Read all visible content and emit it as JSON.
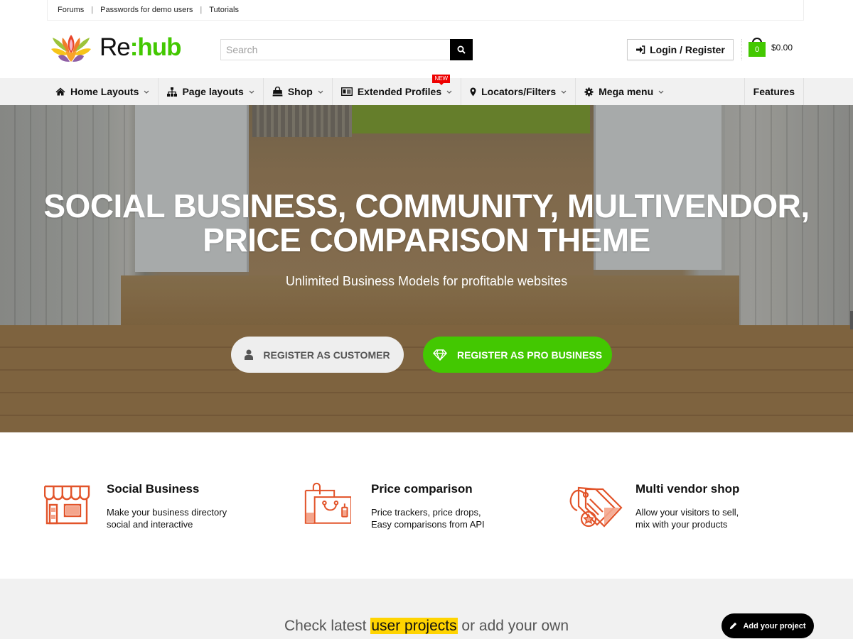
{
  "topbar": {
    "links": [
      "Forums",
      "Passwords for demo users",
      "Tutorials"
    ]
  },
  "header": {
    "logo": {
      "prefix": "Re",
      "suffix": ":hub"
    },
    "search": {
      "placeholder": "Search",
      "value": ""
    },
    "login_label": "Login / Register",
    "cart": {
      "count": "0",
      "total": "$0.00"
    }
  },
  "nav": {
    "items": [
      {
        "label": "Home Layouts",
        "icon": "home-icon",
        "dropdown": true
      },
      {
        "label": "Page layouts",
        "icon": "sitemap-icon",
        "dropdown": true
      },
      {
        "label": "Shop",
        "icon": "shopping-bag-icon",
        "dropdown": true
      },
      {
        "label": "Extended Profiles",
        "icon": "id-card-icon",
        "dropdown": true,
        "badge": "NEW"
      },
      {
        "label": "Locators/Filters",
        "icon": "map-marker-icon",
        "dropdown": true
      },
      {
        "label": "Mega menu",
        "icon": "gear-icon",
        "dropdown": true
      }
    ],
    "right_item": "Features"
  },
  "hero": {
    "title_line1": "SOCIAL BUSINESS, COMMUNITY, MULTIVENDOR,",
    "title_line2": "PRICE COMPARISON THEME",
    "subtitle": "Unlimited Business Models for profitable websites",
    "btn_customer": "REGISTER AS CUSTOMER",
    "btn_pro": "REGISTER AS PRO BUSINESS"
  },
  "features": [
    {
      "title": "Social Business",
      "desc_line1": "Make your business directory",
      "desc_line2": "social and interactive",
      "icon": "storefront-icon"
    },
    {
      "title": "Price comparison",
      "desc_line1": "Price trackers, price drops,",
      "desc_line2": "Easy comparisons from API",
      "icon": "shopping-bags-icon"
    },
    {
      "title": "Multi vendor shop",
      "desc_line1": "Allow your visitors to sell,",
      "desc_line2": "mix with your products",
      "icon": "price-tags-icon"
    }
  ],
  "bottom": {
    "text_before": "Check latest ",
    "highlight": "user projects",
    "text_after": " or add your own",
    "add_button": "Add your project"
  },
  "colors": {
    "brand_green": "#43c801",
    "accent_orange": "#e2542a",
    "highlight_yellow": "#ffd400",
    "badge_red": "#ee0000"
  }
}
